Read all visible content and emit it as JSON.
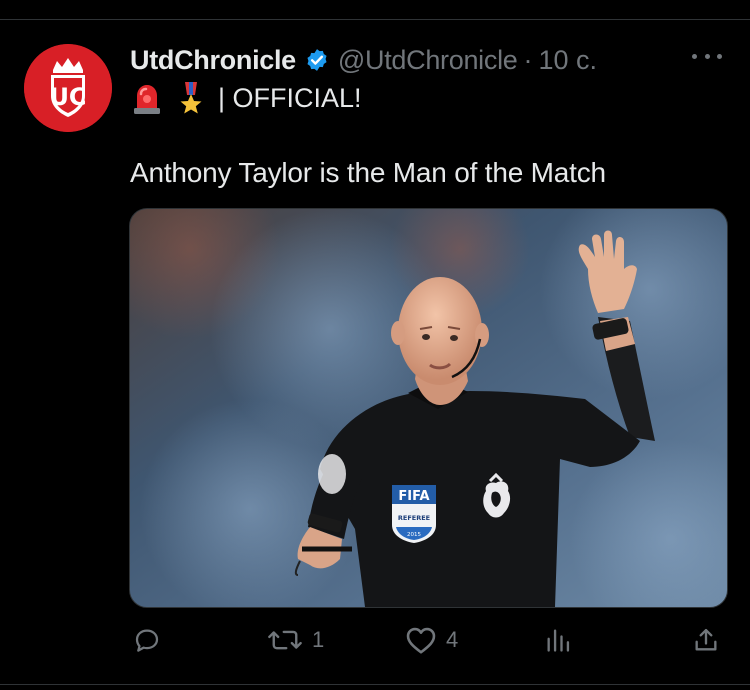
{
  "tweet": {
    "author": {
      "display_name": "UtdChronicle",
      "handle": "@UtdChronicle",
      "verified": true,
      "avatar_initials": "UC"
    },
    "time": "10 с.",
    "separator": "·",
    "lines": {
      "official": "| OFFICIAL!"
    },
    "emojis": [
      "siren-emoji",
      "military-medal-emoji"
    ],
    "text": "Anthony Taylor is the Man of the Match",
    "media": {
      "badge_fifa": "FIFA",
      "badge_referee": "REFEREE",
      "badge_year": "2015"
    },
    "actions": {
      "reply_count": "",
      "retweet_count": "1",
      "like_count": "4",
      "views_count": ""
    }
  },
  "colors": {
    "background": "#000000",
    "text_primary": "#e7e9ea",
    "text_secondary": "#71767b",
    "verified_blue": "#1d9bf0",
    "avatar_red": "#d81f26",
    "divider": "#2f3336"
  }
}
